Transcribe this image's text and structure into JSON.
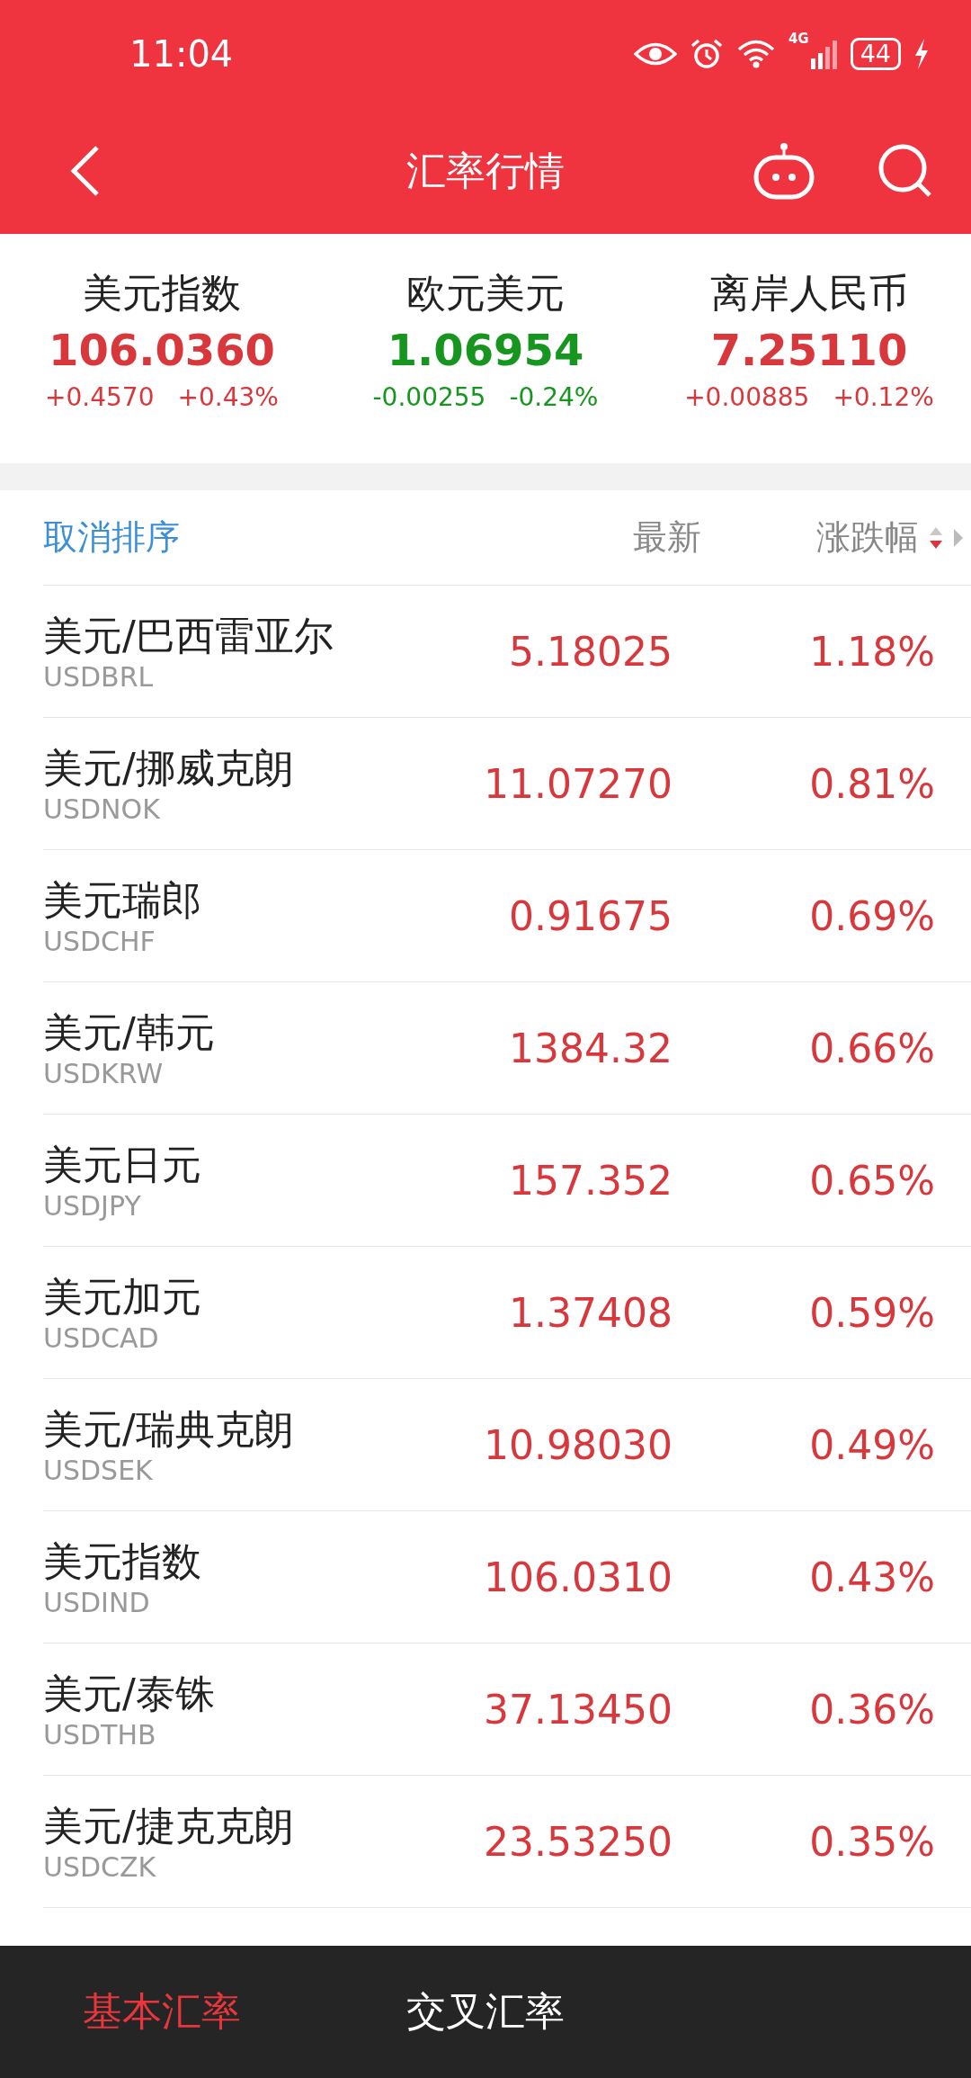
{
  "status_bar": {
    "time": "11:04",
    "network": "4G",
    "battery": "44"
  },
  "header": {
    "title": "汇率行情"
  },
  "summary": [
    {
      "name": "美元指数",
      "value": "106.0360",
      "change": "+0.4570",
      "percent": "+0.43%",
      "rising": true
    },
    {
      "name": "欧元美元",
      "value": "1.06954",
      "change": "-0.00255",
      "percent": "-0.24%",
      "rising": false
    },
    {
      "name": "离岸人民币",
      "value": "7.25110",
      "change": "+0.00885",
      "percent": "+0.12%",
      "rising": true
    }
  ],
  "table": {
    "cancel_sort": "取消排序",
    "columns": [
      "最新",
      "涨跌幅"
    ],
    "sort_descending": true,
    "rows": [
      {
        "name": "美元/巴西雷亚尔",
        "code": "USDBRL",
        "price": "5.18025",
        "percent": "1.18%"
      },
      {
        "name": "美元/挪威克朗",
        "code": "USDNOK",
        "price": "11.07270",
        "percent": "0.81%"
      },
      {
        "name": "美元瑞郎",
        "code": "USDCHF",
        "price": "0.91675",
        "percent": "0.69%"
      },
      {
        "name": "美元/韩元",
        "code": "USDKRW",
        "price": "1384.32",
        "percent": "0.66%"
      },
      {
        "name": "美元日元",
        "code": "USDJPY",
        "price": "157.352",
        "percent": "0.65%"
      },
      {
        "name": "美元加元",
        "code": "USDCAD",
        "price": "1.37408",
        "percent": "0.59%"
      },
      {
        "name": "美元/瑞典克朗",
        "code": "USDSEK",
        "price": "10.98030",
        "percent": "0.49%"
      },
      {
        "name": "美元指数",
        "code": "USDIND",
        "price": "106.0310",
        "percent": "0.43%"
      },
      {
        "name": "美元/泰铢",
        "code": "USDTHB",
        "price": "37.13450",
        "percent": "0.36%"
      },
      {
        "name": "美元/捷克克朗",
        "code": "USDCZK",
        "price": "23.53250",
        "percent": "0.35%"
      }
    ]
  },
  "bottom_tabs": [
    {
      "label": "基本汇率",
      "selected": true
    },
    {
      "label": "交叉汇率",
      "selected": false
    }
  ]
}
